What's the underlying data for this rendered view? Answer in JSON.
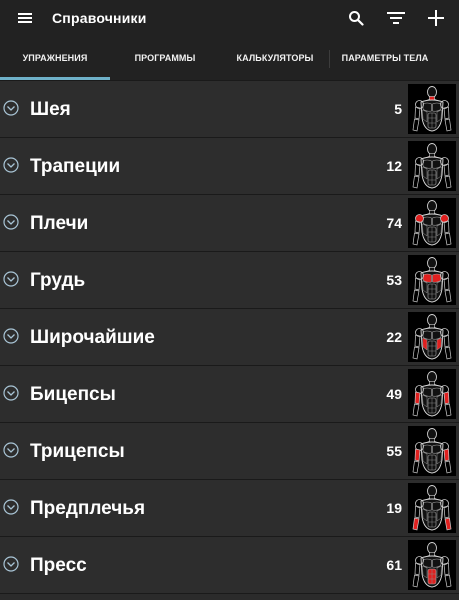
{
  "appbar": {
    "title": "Справочники",
    "icons": [
      "menu-icon",
      "search-icon",
      "filter-icon",
      "plus-icon"
    ]
  },
  "tabs": [
    {
      "label": "УПРАЖНЕНИЯ",
      "active": true
    },
    {
      "label": "ПРОГРАММЫ",
      "active": false
    },
    {
      "label": "КАЛЬКУЛЯТОРЫ",
      "active": false
    },
    {
      "label": "ПАРАМЕТРЫ ТЕЛА",
      "active": false
    }
  ],
  "muscle_groups": [
    {
      "label": "Шея",
      "count": "5",
      "highlight": "neck"
    },
    {
      "label": "Трапеции",
      "count": "12",
      "highlight": "traps"
    },
    {
      "label": "Плечи",
      "count": "74",
      "highlight": "shoulders"
    },
    {
      "label": "Грудь",
      "count": "53",
      "highlight": "chest"
    },
    {
      "label": "Широчайшие",
      "count": "22",
      "highlight": "lats"
    },
    {
      "label": "Бицепсы",
      "count": "49",
      "highlight": "biceps"
    },
    {
      "label": "Трицепсы",
      "count": "55",
      "highlight": "triceps"
    },
    {
      "label": "Предплечья",
      "count": "19",
      "highlight": "forearms"
    },
    {
      "label": "Пресс",
      "count": "61",
      "highlight": "abs"
    }
  ],
  "colors": {
    "background": "#2b2b2b",
    "appbar": "#222222",
    "tab_indicator": "#6fb1c9",
    "chevron": "#a9c5d6",
    "muscle_highlight": "#e0201f"
  }
}
